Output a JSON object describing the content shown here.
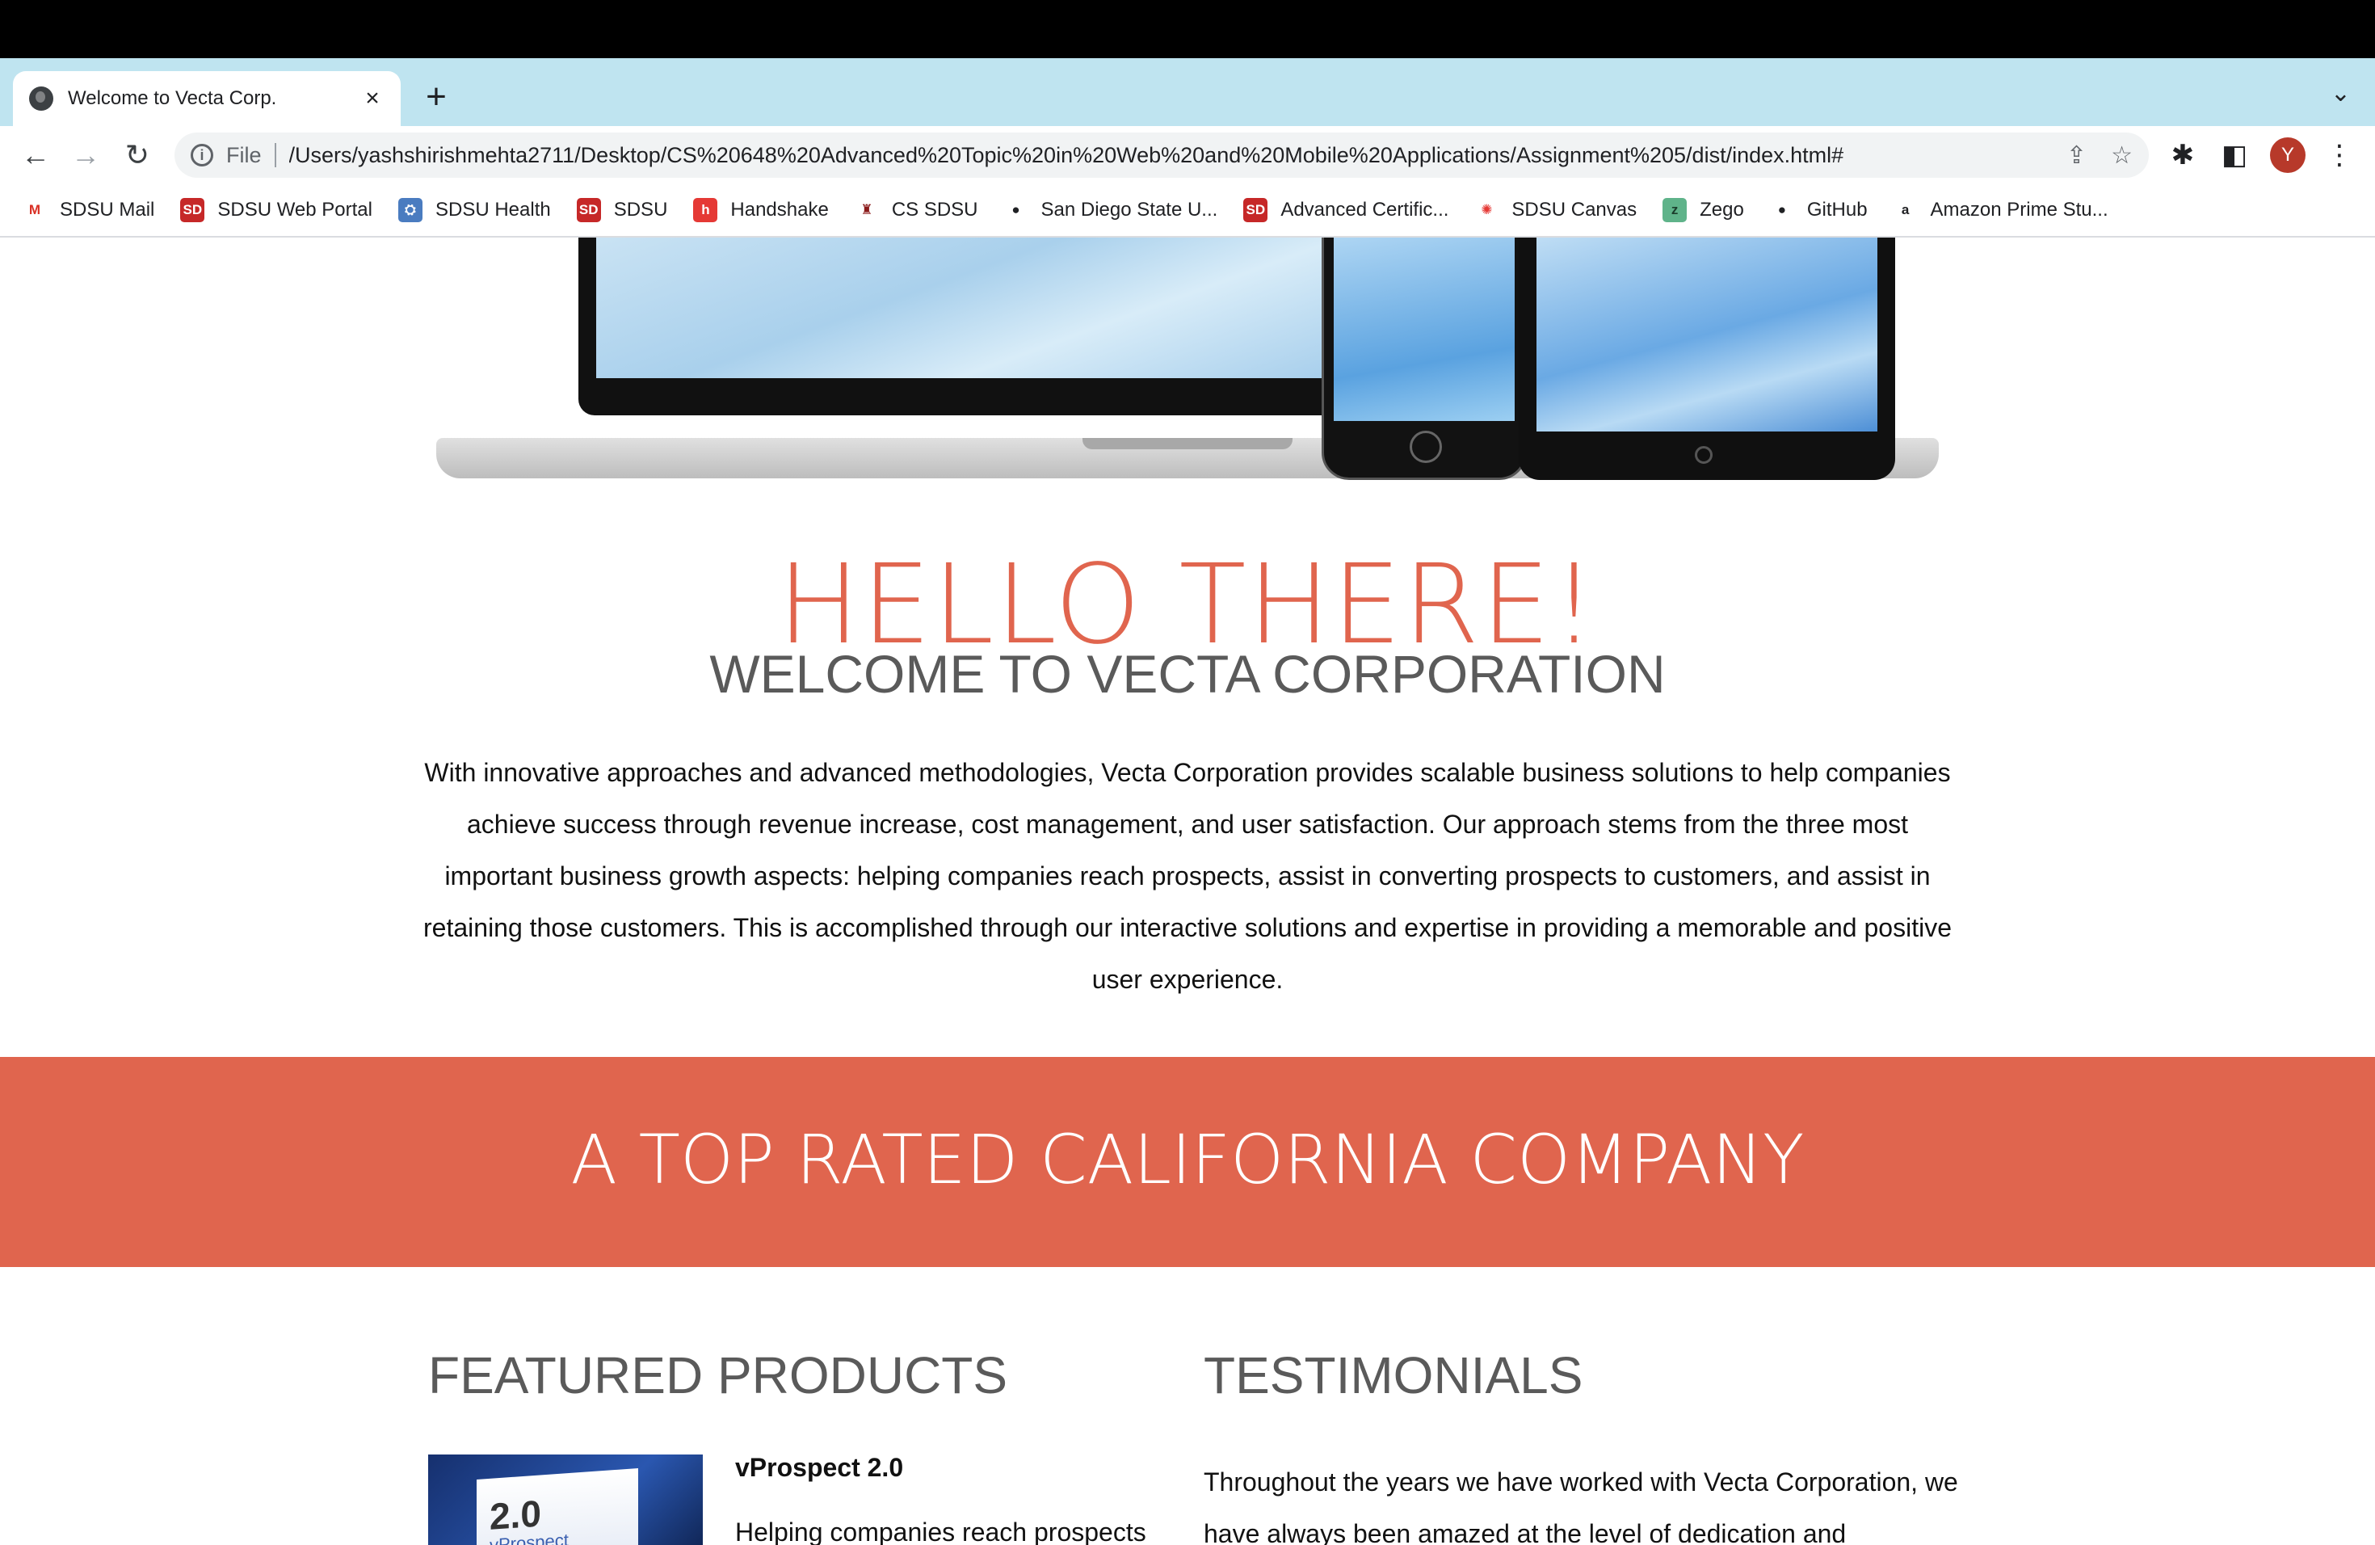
{
  "browser": {
    "tab_title": "Welcome to Vecta Corp.",
    "tab_close": "×",
    "new_tab": "+",
    "tab_menu": "⌄",
    "back": "←",
    "forward": "→",
    "reload": "↻",
    "info": "i",
    "scheme": "File",
    "url": "/Users/yashshirishmehta2711/Desktop/CS%20648%20Advanced%20Topic%20in%20Web%20and%20Mobile%20Applications/Assignment%205/dist/index.html#",
    "share_icon": "⇪",
    "star_icon": "☆",
    "extensions_icon": "✱",
    "sidepanel_icon": "◧",
    "avatar_letter": "Y",
    "menu_icon": "⋮",
    "bookmarks": [
      {
        "label": "SDSU Mail",
        "icon": "M",
        "color": "#ffffff",
        "fg": "#d93025"
      },
      {
        "label": "SDSU Web Portal",
        "icon": "SD",
        "color": "#c62828",
        "fg": "#ffffff"
      },
      {
        "label": "SDSU Health",
        "icon": "⛭",
        "color": "#4a7cc0",
        "fg": "#ffffff"
      },
      {
        "label": "SDSU",
        "icon": "SD",
        "color": "#c62828",
        "fg": "#ffffff"
      },
      {
        "label": "Handshake",
        "icon": "h",
        "color": "#e53935",
        "fg": "#ffffff"
      },
      {
        "label": "CS SDSU",
        "icon": "♜",
        "color": "#ffffff",
        "fg": "#8b1a1a"
      },
      {
        "label": "San Diego State U...",
        "icon": "●",
        "color": "#ffffff",
        "fg": "#202124"
      },
      {
        "label": "Advanced Certific...",
        "icon": "SD",
        "color": "#c62828",
        "fg": "#ffffff"
      },
      {
        "label": "SDSU Canvas",
        "icon": "✺",
        "color": "#ffffff",
        "fg": "#e53935"
      },
      {
        "label": "Zego",
        "icon": "z",
        "color": "#5fb38a",
        "fg": "#1b3d2c"
      },
      {
        "label": "GitHub",
        "icon": "●",
        "color": "#ffffff",
        "fg": "#202124"
      },
      {
        "label": "Amazon Prime Stu...",
        "icon": "a",
        "color": "#ffffff",
        "fg": "#202124"
      }
    ]
  },
  "page": {
    "hello": "HELLO THERE!",
    "welcome": "WELCOME TO VECTA CORPORATION",
    "intro": "With innovative approaches and advanced methodologies, Vecta Corporation provides scalable business solutions to help companies achieve success through revenue increase, cost management, and user satisfaction. Our approach stems from the three most important business growth aspects: helping companies reach prospects, assist in converting prospects to customers, and assist in retaining those customers. This is accomplished through our interactive solutions and expertise in providing a memorable and positive user experience.",
    "band_title": "A TOP RATED CALIFORNIA COMPANY",
    "featured_title": "FEATURED PRODUCTS",
    "testimonials_title": "TESTIMONIALS",
    "product": {
      "box_version": "2.0",
      "box_name": "vProspect",
      "name": "vProspect 2.0",
      "desc": "Helping companies reach prospects"
    },
    "testimonial": "Throughout the years we have worked with Vecta Corporation, we have always been amazed at the level of dedication and"
  },
  "colors": {
    "accent": "#e0654e",
    "tabstrip": "#bfe4f0",
    "heading_gray": "#5a5a5a"
  }
}
